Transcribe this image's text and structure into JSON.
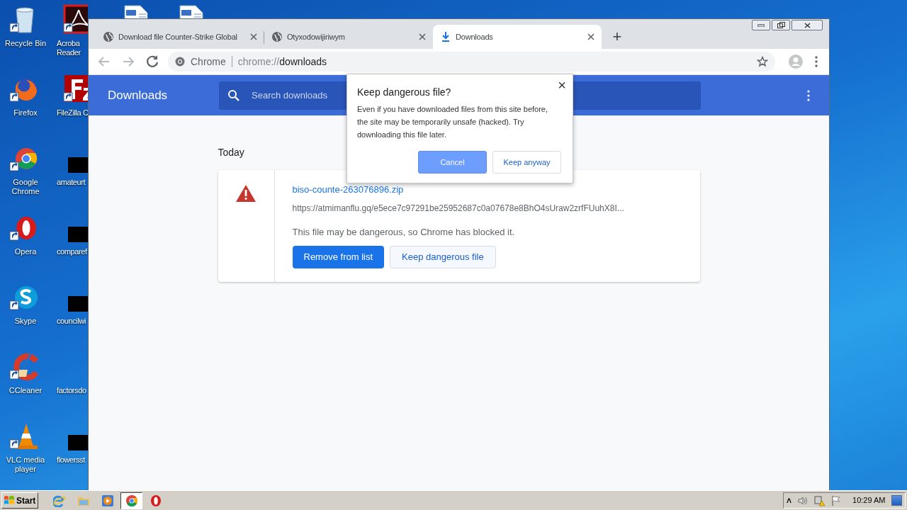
{
  "desktop": {
    "columns": [
      [
        {
          "kind": "recycle",
          "label": [
            "Recycle Bin"
          ]
        },
        {
          "kind": "firefox",
          "label": [
            "Firefox"
          ]
        },
        {
          "kind": "chrome",
          "label": [
            "Google",
            "Chrome"
          ]
        },
        {
          "kind": "opera",
          "label": [
            "Opera"
          ]
        },
        {
          "kind": "skype",
          "label": [
            "Skype"
          ]
        },
        {
          "kind": "ccleaner",
          "label": [
            "CCleaner"
          ]
        },
        {
          "kind": "vlc",
          "label": [
            "VLC media",
            "player"
          ]
        }
      ],
      [
        {
          "kind": "acrobat",
          "label": [
            "Acroba",
            "Reader"
          ]
        },
        {
          "kind": "filezilla",
          "label": [
            "FileZilla C"
          ]
        },
        {
          "kind": "redacted",
          "label": [
            "amateurt"
          ]
        },
        {
          "kind": "redacted",
          "label": [
            "comparef"
          ]
        },
        {
          "kind": "redacted",
          "label": [
            "councilwi"
          ]
        },
        {
          "kind": "blank",
          "label": [
            "factorsdo"
          ]
        },
        {
          "kind": "redacted",
          "label": [
            "flowersst"
          ]
        }
      ],
      [
        {
          "kind": "file"
        }
      ],
      [
        {
          "kind": "file"
        }
      ]
    ]
  },
  "browser": {
    "tabs": [
      {
        "title": "Download file Counter-Strike Global",
        "kind": "page",
        "selected": false
      },
      {
        "title": "Otyxodowijiriwym",
        "kind": "page",
        "selected": false
      },
      {
        "title": "Downloads",
        "kind": "downloads",
        "selected": true
      }
    ],
    "new_tab": "+",
    "omnibox": {
      "origin": "Chrome",
      "scheme": "chrome://",
      "path": "downloads"
    },
    "header": {
      "title": "Downloads",
      "search_placeholder": "Search downloads"
    },
    "sections": [
      {
        "date": "Today",
        "items": [
          {
            "filename": "biso-counte-263076896.zip",
            "url": "https://atmimanflu.gq/e5ece7c97291be25952687c0a07678e8BhO4sUraw2zrfFUuhX8I...",
            "status": "This file may be dangerous, so Chrome has blocked it.",
            "buttons": [
              {
                "label": "Remove from list",
                "kind": "primary"
              },
              {
                "label": "Keep dangerous file",
                "kind": "secondary"
              }
            ]
          }
        ]
      }
    ],
    "dialog": {
      "title": "Keep dangerous file?",
      "body": "Even if you have downloaded files from this site before, the site may be temporarily unsafe (hacked). Try downloading this file later.",
      "close": "×",
      "buttons": [
        {
          "label": "Cancel",
          "kind": "focused"
        },
        {
          "label": "Keep anyway",
          "kind": "plain"
        }
      ]
    }
  },
  "taskbar": {
    "start": "Start",
    "apps": [
      {
        "kind": "ie",
        "active": false
      },
      {
        "kind": "folder",
        "active": false
      },
      {
        "kind": "media",
        "active": false
      },
      {
        "kind": "chrome",
        "active": true
      },
      {
        "kind": "opera",
        "active": false
      }
    ],
    "tray": {
      "expand": "˄",
      "time": "10:29 AM"
    }
  }
}
